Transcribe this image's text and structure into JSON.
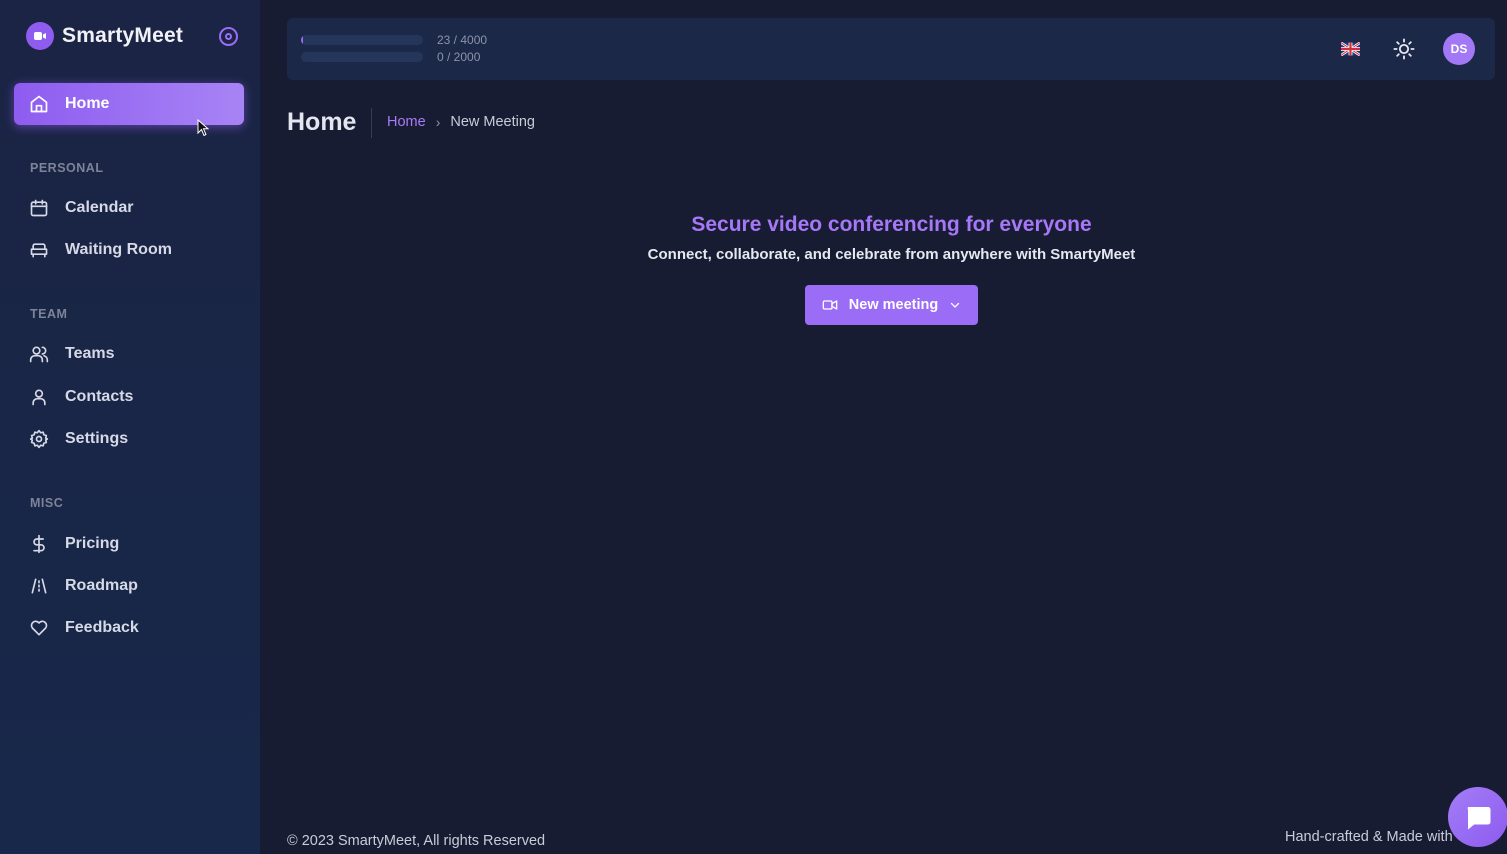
{
  "brand": {
    "name": "SmartyMeet"
  },
  "sidebar": {
    "home": {
      "label": "Home",
      "icon": "home-icon"
    },
    "sections": [
      {
        "label": "PERSONAL"
      },
      {
        "label": "TEAM"
      },
      {
        "label": "MISC"
      }
    ],
    "items": [
      {
        "label": "Calendar",
        "icon": "calendar-icon"
      },
      {
        "label": "Waiting Room",
        "icon": "sofa-icon"
      },
      {
        "label": "Teams",
        "icon": "users-icon"
      },
      {
        "label": "Contacts",
        "icon": "user-icon"
      },
      {
        "label": "Settings",
        "icon": "gear-icon"
      },
      {
        "label": "Pricing",
        "icon": "dollar-icon"
      },
      {
        "label": "Roadmap",
        "icon": "road-icon"
      },
      {
        "label": "Feedback",
        "icon": "heart-icon"
      }
    ]
  },
  "topbar": {
    "usage": [
      {
        "text": "23 / 4000",
        "fraction": 0.00575
      },
      {
        "text": "0 / 2000",
        "fraction": 0
      }
    ],
    "avatar_initials": "DS"
  },
  "header": {
    "title": "Home",
    "breadcrumb": {
      "link": "Home",
      "current": "New Meeting"
    }
  },
  "hero": {
    "title": "Secure video conferencing for everyone",
    "subtitle": "Connect, collaborate, and celebrate from anywhere with SmartyMeet",
    "button_label": "New meeting"
  },
  "footer": {
    "copyright": "© 2023 SmartyMeet, All rights Reserved",
    "madewith": "Hand-crafted & Made with"
  },
  "colors": {
    "accent": "#9b6cf5",
    "background": "#171c32",
    "sidebar": "#1b2444"
  }
}
